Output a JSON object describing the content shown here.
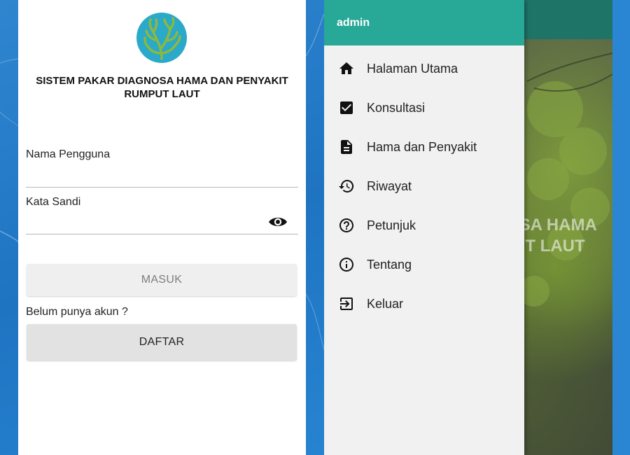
{
  "colors": {
    "drawer_header": "#28a897",
    "app_bar": "#1f7468",
    "logo_bg": "#2aa9c9",
    "logo_plant": "#8db83f",
    "desktop_bg": "#1f74c2"
  },
  "login": {
    "logo_icon": "seaweed-logo",
    "title": "SISTEM PAKAR DIAGNOSA HAMA DAN PENYAKIT RUMPUT LAUT",
    "username_label": "Nama Pengguna",
    "username_value": "",
    "password_label": "Kata Sandi",
    "password_value": "",
    "password_toggle_icon": "eye-icon",
    "login_button": "MASUK",
    "register_hint": "Belum punya akun ?",
    "register_button": "DAFTAR"
  },
  "drawer": {
    "header": "admin",
    "items": [
      {
        "label": "Halaman Utama",
        "icon": "home-icon"
      },
      {
        "label": "Konsultasi",
        "icon": "checkbox-icon"
      },
      {
        "label": "Hama dan Penyakit",
        "icon": "document-icon"
      },
      {
        "label": "Riwayat",
        "icon": "history-icon"
      },
      {
        "label": "Petunjuk",
        "icon": "help-icon"
      },
      {
        "label": "Tentang",
        "icon": "info-icon"
      },
      {
        "label": "Keluar",
        "icon": "exit-icon"
      }
    ]
  },
  "background_screen": {
    "title_line1": "OSA HAMA",
    "title_line2": "UT LAUT"
  }
}
